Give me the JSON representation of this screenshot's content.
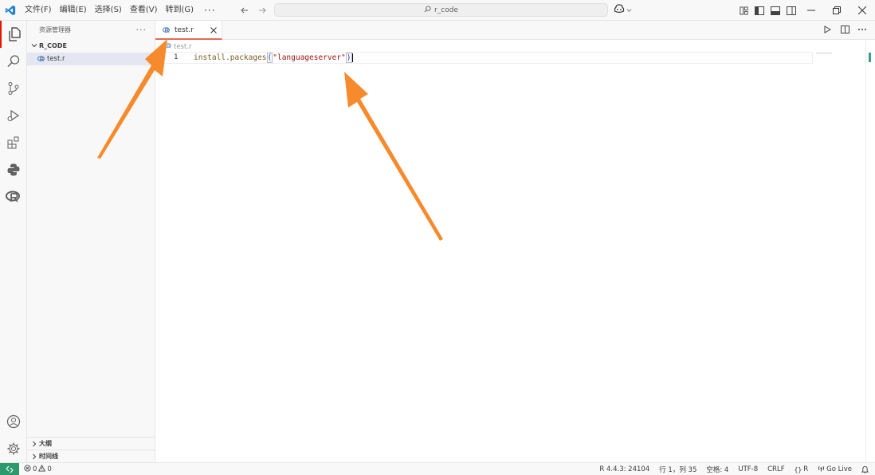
{
  "menu": {
    "file": "文件(F)",
    "edit": "编辑(E)",
    "selection": "选择(S)",
    "view": "查看(V)",
    "goto": "转到(G)",
    "more": "···"
  },
  "command_center": {
    "text": "r_code"
  },
  "sidebar": {
    "title": "资源管理器",
    "more": "···",
    "folder": "R_CODE",
    "files": [
      "test.r"
    ],
    "outline": "大纲",
    "timeline": "时间线"
  },
  "editor": {
    "tab_label": "test.r",
    "breadcrumb": "test.r",
    "line_number": "1",
    "code": {
      "fn": "install.packages",
      "open": "(",
      "str": "\"languageserver\"",
      "close": ")"
    }
  },
  "statusbar": {
    "errors": "0",
    "warnings": "0",
    "r_version": "R 4.4.3: 24104",
    "position": "行 1，列 35",
    "spaces": "空格: 4",
    "encoding": "UTF-8",
    "eol": "CRLF",
    "language": "R",
    "go_live": "Go Live"
  },
  "colors": {
    "accent_tab": "#e26b57",
    "remote": "#2c9a6c",
    "arrow": "#f68a2c",
    "activity_active": "#e51400"
  },
  "icons": {
    "logo": "vscode-logo-icon",
    "explorer": "files-icon",
    "search": "search-icon",
    "scm": "source-control-icon",
    "debug": "run-debug-icon",
    "extensions": "extensions-icon",
    "python": "python-icon",
    "r": "r-icon",
    "account": "account-icon",
    "settings": "gear-icon"
  }
}
